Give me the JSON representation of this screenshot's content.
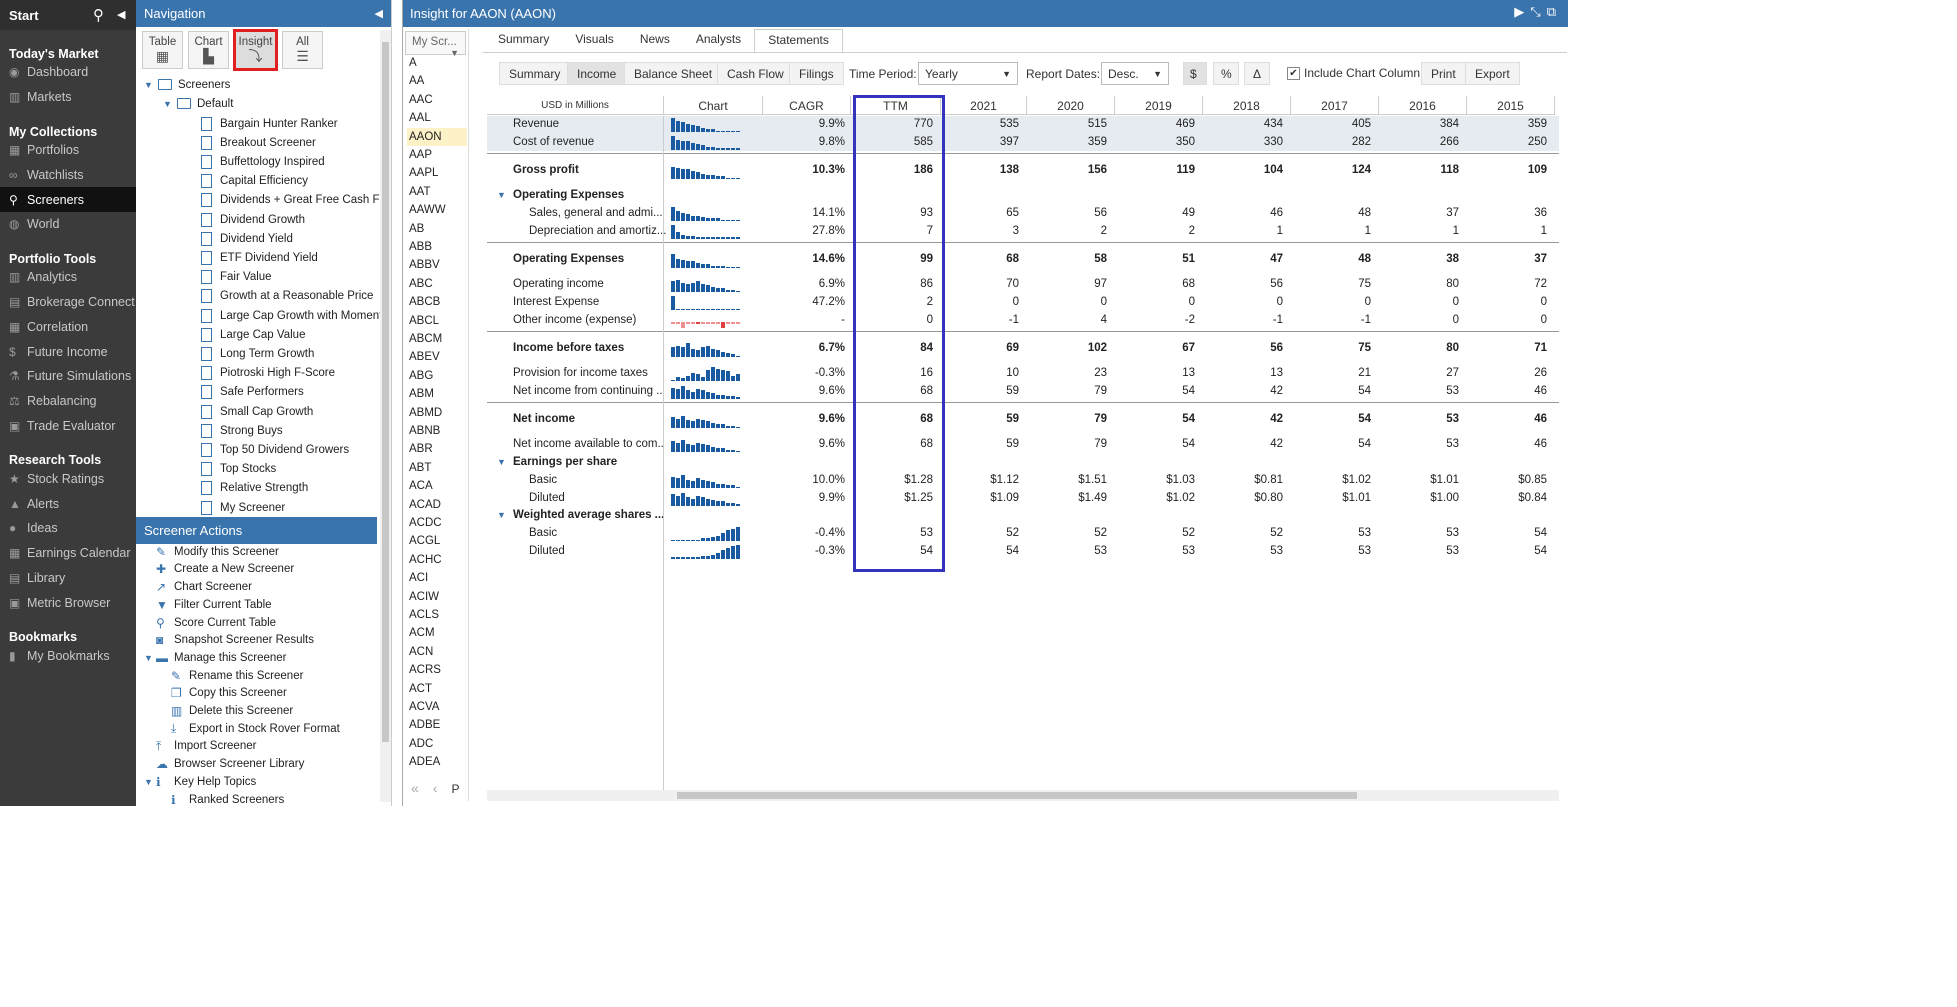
{
  "left": {
    "start": "Start",
    "sections": [
      {
        "title": "Today's Market",
        "items": [
          {
            "label": "Dashboard",
            "icon": "dashboard-icon",
            "g": "◉"
          },
          {
            "label": "Markets",
            "icon": "markets-icon",
            "g": "▥"
          }
        ]
      },
      {
        "title": "My Collections",
        "items": [
          {
            "label": "Portfolios",
            "icon": "portfolio-icon",
            "g": "▦"
          },
          {
            "label": "Watchlists",
            "icon": "binoculars-icon",
            "g": "∞"
          },
          {
            "label": "Screeners",
            "icon": "search-icon",
            "g": "⚲",
            "active": true
          },
          {
            "label": "World",
            "icon": "globe-icon",
            "g": "◍"
          }
        ]
      },
      {
        "title": "Portfolio Tools",
        "items": [
          {
            "label": "Analytics",
            "icon": "analytics-icon",
            "g": "▥"
          },
          {
            "label": "Brokerage Connect",
            "icon": "brokerage-icon",
            "g": "▤"
          },
          {
            "label": "Correlation",
            "icon": "grid-icon",
            "g": "▦"
          },
          {
            "label": "Future Income",
            "icon": "dollar-icon",
            "g": "$"
          },
          {
            "label": "Future Simulations",
            "icon": "flask-icon",
            "g": "⚗"
          },
          {
            "label": "Rebalancing",
            "icon": "scale-icon",
            "g": "⚖"
          },
          {
            "label": "Trade Evaluator",
            "icon": "briefcase-icon",
            "g": "▣"
          }
        ]
      },
      {
        "title": "Research Tools",
        "items": [
          {
            "label": "Stock Ratings",
            "icon": "star-icon",
            "g": "★"
          },
          {
            "label": "Alerts",
            "icon": "bell-icon",
            "g": "▲"
          },
          {
            "label": "Ideas",
            "icon": "bulb-icon",
            "g": "●"
          },
          {
            "label": "Earnings Calendar",
            "icon": "calendar-icon",
            "g": "▦"
          },
          {
            "label": "Library",
            "icon": "library-icon",
            "g": "▤"
          },
          {
            "label": "Metric Browser",
            "icon": "metric-icon",
            "g": "▣"
          }
        ]
      },
      {
        "title": "Bookmarks",
        "items": [
          {
            "label": "My Bookmarks",
            "icon": "bookmark-icon",
            "g": "▮"
          }
        ]
      }
    ]
  },
  "nav": {
    "title": "Navigation",
    "views": [
      "Table",
      "Chart",
      "Insight",
      "All"
    ],
    "screeners": "Screeners",
    "default": "Default",
    "items": [
      "Bargain Hunter Ranker",
      "Breakout Screener",
      "Buffettology Inspired",
      "Capital Efficiency",
      "Dividends + Great Free Cash Flow",
      "Dividend Growth",
      "Dividend Yield",
      "ETF Dividend Yield",
      "Fair Value",
      "Growth at a Reasonable Price",
      "Large Cap Growth with Momentum",
      "Large Cap Value",
      "Long Term Growth",
      "Piotroski High F-Score",
      "Safe Performers",
      "Small Cap Growth",
      "Strong Buys",
      "Top 50 Dividend Growers",
      "Top Stocks",
      "Relative Strength",
      "My Screener"
    ],
    "actions_title": "Screener Actions",
    "actions": [
      {
        "label": "Modify this Screener",
        "g": "✎",
        "indent": 0
      },
      {
        "label": "Create a New Screener",
        "g": "✚",
        "indent": 0
      },
      {
        "label": "Chart Screener",
        "g": "↗",
        "indent": 0
      },
      {
        "label": "Filter Current Table",
        "g": "▼",
        "indent": 0
      },
      {
        "label": "Score Current Table",
        "g": "⚲",
        "indent": 0
      },
      {
        "label": "Snapshot Screener Results",
        "g": "◙",
        "indent": 0
      },
      {
        "label": "Manage this Screener",
        "g": "▬",
        "indent": 0,
        "twisty": true
      },
      {
        "label": "Rename this Screener",
        "g": "✎",
        "indent": 1
      },
      {
        "label": "Copy this Screener",
        "g": "❐",
        "indent": 1
      },
      {
        "label": "Delete this Screener",
        "g": "▥",
        "indent": 1
      },
      {
        "label": "Export in Stock Rover Format",
        "g": "⤓",
        "indent": 1
      },
      {
        "label": "Import Screener",
        "g": "⤒",
        "indent": 0
      },
      {
        "label": "Browser Screener Library",
        "g": "☁",
        "indent": 0
      },
      {
        "label": "Key Help Topics",
        "g": "ℹ",
        "indent": 0,
        "twisty": true
      },
      {
        "label": "Ranked Screeners",
        "g": "ℹ",
        "indent": 1
      }
    ]
  },
  "main": {
    "title": "Insight for AAON (AAON)",
    "ticker_header": "My Scr...",
    "tickers": [
      "A",
      "AA",
      "AAC",
      "AAL",
      "AAON",
      "AAP",
      "AAPL",
      "AAT",
      "AAWW",
      "AB",
      "ABB",
      "ABBV",
      "ABC",
      "ABCB",
      "ABCL",
      "ABCM",
      "ABEV",
      "ABG",
      "ABM",
      "ABMD",
      "ABNB",
      "ABR",
      "ABT",
      "ACA",
      "ACAD",
      "ACDC",
      "ACGL",
      "ACHC",
      "ACI",
      "ACIW",
      "ACLS",
      "ACM",
      "ACN",
      "ACRS",
      "ACT",
      "ACVA",
      "ADBE",
      "ADC",
      "ADEA"
    ],
    "tabs": [
      "Summary",
      "Visuals",
      "News",
      "Analysts",
      "Statements"
    ],
    "subtabs": [
      "Summary",
      "Income",
      "Balance Sheet",
      "Cash Flow",
      "Filings"
    ],
    "period_label": "Time Period:",
    "period": "Yearly",
    "report_label": "Report Dates:",
    "report": "Desc.",
    "fmt": [
      "$",
      "%",
      "Δ"
    ],
    "include": "Include Chart Column",
    "print": "Print",
    "export": "Export",
    "pager": "P"
  },
  "table": {
    "columns": [
      "USD in Millions",
      "Chart",
      "CAGR",
      "TTM",
      "2021",
      "2020",
      "2019",
      "2018",
      "2017",
      "2016",
      "2015"
    ],
    "rows": [
      {
        "label": "Revenue",
        "indent": 0,
        "bold": false,
        "hl": true,
        "cagr": "9.9%",
        "v": [
          "770",
          "535",
          "515",
          "469",
          "434",
          "405",
          "384",
          "359"
        ],
        "s": [
          10,
          8,
          7,
          6,
          5,
          4,
          3,
          2,
          2,
          1,
          1,
          1,
          1,
          1
        ]
      },
      {
        "label": "Cost of revenue",
        "indent": 0,
        "bold": false,
        "hl": true,
        "cagr": "9.8%",
        "v": [
          "585",
          "397",
          "359",
          "350",
          "330",
          "282",
          "266",
          "250"
        ],
        "s": [
          10,
          7,
          6,
          6,
          5,
          4,
          3,
          2,
          2,
          1,
          1,
          1,
          1,
          1
        ]
      },
      {
        "label": "Gross profit",
        "indent": 0,
        "bold": true,
        "gap": true,
        "cagr": "10.3%",
        "v": [
          "186",
          "138",
          "156",
          "119",
          "104",
          "124",
          "118",
          "109"
        ],
        "s": [
          9,
          8,
          7,
          7,
          6,
          5,
          4,
          3,
          3,
          2,
          2,
          1,
          1,
          1
        ]
      },
      {
        "label": "Operating Expenses",
        "indent": 0,
        "bold": true,
        "section": true,
        "cagr": "",
        "v": [
          "",
          "",
          "",
          "",
          "",
          "",
          "",
          ""
        ],
        "s": []
      },
      {
        "label": "Sales, general and admi...",
        "indent": 1,
        "bold": false,
        "cagr": "14.1%",
        "v": [
          "93",
          "65",
          "56",
          "49",
          "46",
          "48",
          "37",
          "36"
        ],
        "s": [
          10,
          7,
          6,
          5,
          4,
          4,
          3,
          2,
          2,
          2,
          1,
          1,
          1,
          1
        ]
      },
      {
        "label": "Depreciation and amortiz...",
        "indent": 1,
        "bold": false,
        "cagr": "27.8%",
        "v": [
          "7",
          "3",
          "2",
          "2",
          "1",
          "1",
          "1",
          "1"
        ],
        "s": [
          10,
          5,
          3,
          2,
          2,
          1,
          1,
          1,
          1,
          1,
          1,
          1,
          1,
          1
        ]
      },
      {
        "label": "Operating Expenses",
        "indent": 0,
        "bold": true,
        "gap": true,
        "cagr": "14.6%",
        "v": [
          "99",
          "68",
          "58",
          "51",
          "47",
          "48",
          "38",
          "37"
        ],
        "s": [
          10,
          7,
          6,
          5,
          5,
          4,
          3,
          3,
          2,
          2,
          2,
          1,
          1,
          1
        ]
      },
      {
        "label": "Operating income",
        "indent": 0,
        "bold": false,
        "cagr": "6.9%",
        "v": [
          "86",
          "70",
          "97",
          "68",
          "56",
          "75",
          "80",
          "72"
        ],
        "s": [
          8,
          9,
          7,
          6,
          7,
          8,
          6,
          5,
          4,
          3,
          3,
          2,
          2,
          1
        ]
      },
      {
        "label": "Interest Expense",
        "indent": 0,
        "bold": false,
        "cagr": "47.2%",
        "v": [
          "2",
          "0",
          "0",
          "0",
          "0",
          "0",
          "0",
          "0"
        ],
        "s": [
          10,
          1,
          1,
          1,
          1,
          1,
          1,
          1,
          1,
          1,
          1,
          1,
          1,
          1
        ]
      },
      {
        "label": "Other income (expense)",
        "indent": 0,
        "bold": false,
        "red": true,
        "cagr": "-",
        "v": [
          "0",
          "-1",
          "4",
          "-2",
          "-1",
          "-1",
          "0",
          "0"
        ],
        "s": [
          2,
          2,
          5,
          3,
          2,
          2,
          2,
          2,
          2,
          2,
          6,
          2,
          2,
          2
        ]
      },
      {
        "label": "Income before taxes",
        "indent": 0,
        "bold": true,
        "gap": true,
        "cagr": "6.7%",
        "v": [
          "84",
          "69",
          "102",
          "67",
          "56",
          "75",
          "80",
          "71"
        ],
        "s": [
          7,
          8,
          7,
          10,
          6,
          5,
          7,
          8,
          6,
          5,
          4,
          3,
          2,
          1
        ]
      },
      {
        "label": "Provision for income taxes",
        "indent": 0,
        "bold": false,
        "cagr": "-0.3%",
        "v": [
          "16",
          "10",
          "23",
          "13",
          "13",
          "21",
          "27",
          "26"
        ],
        "s": [
          1,
          3,
          2,
          4,
          6,
          5,
          3,
          8,
          10,
          9,
          8,
          7,
          4,
          5
        ]
      },
      {
        "label": "Net income from continuing ...",
        "indent": 0,
        "bold": false,
        "cagr": "9.6%",
        "v": [
          "68",
          "59",
          "79",
          "54",
          "42",
          "54",
          "53",
          "46"
        ],
        "s": [
          8,
          7,
          9,
          6,
          5,
          7,
          6,
          5,
          4,
          3,
          3,
          2,
          2,
          1
        ]
      },
      {
        "label": "Net income",
        "indent": 0,
        "bold": true,
        "gap": true,
        "cagr": "9.6%",
        "v": [
          "68",
          "59",
          "79",
          "54",
          "42",
          "54",
          "53",
          "46"
        ],
        "s": [
          8,
          7,
          9,
          6,
          5,
          7,
          6,
          5,
          4,
          3,
          3,
          2,
          2,
          1
        ]
      },
      {
        "label": "Net income available to com...",
        "indent": 0,
        "bold": false,
        "cagr": "9.6%",
        "v": [
          "68",
          "59",
          "79",
          "54",
          "42",
          "54",
          "53",
          "46"
        ],
        "s": [
          8,
          7,
          9,
          6,
          5,
          7,
          6,
          5,
          4,
          3,
          3,
          2,
          2,
          1
        ]
      },
      {
        "label": "Earnings per share",
        "indent": 0,
        "bold": true,
        "section": true,
        "cagr": "",
        "v": [
          "",
          "",
          "",
          "",
          "",
          "",
          "",
          ""
        ],
        "s": []
      },
      {
        "label": "Basic",
        "indent": 1,
        "bold": false,
        "cagr": "10.0%",
        "v": [
          "$1.28",
          "$1.12",
          "$1.51",
          "$1.03",
          "$0.81",
          "$1.02",
          "$1.01",
          "$0.85"
        ],
        "s": [
          8,
          7,
          9,
          6,
          5,
          7,
          6,
          5,
          4,
          3,
          3,
          2,
          2,
          1
        ]
      },
      {
        "label": "Diluted",
        "indent": 1,
        "bold": false,
        "cagr": "9.9%",
        "v": [
          "$1.25",
          "$1.09",
          "$1.49",
          "$1.02",
          "$0.80",
          "$1.01",
          "$1.00",
          "$0.84"
        ],
        "s": [
          8,
          7,
          9,
          6,
          5,
          7,
          6,
          5,
          4,
          3,
          3,
          2,
          2,
          1
        ]
      },
      {
        "label": "Weighted average shares ...",
        "indent": 0,
        "bold": true,
        "section": true,
        "cagr": "",
        "v": [
          "",
          "",
          "",
          "",
          "",
          "",
          "",
          ""
        ],
        "s": []
      },
      {
        "label": "Basic",
        "indent": 1,
        "bold": false,
        "cagr": "-0.4%",
        "v": [
          "53",
          "52",
          "52",
          "52",
          "52",
          "53",
          "53",
          "54"
        ],
        "s": [
          1,
          1,
          1,
          1,
          1,
          1,
          2,
          2,
          3,
          4,
          6,
          8,
          9,
          10
        ]
      },
      {
        "label": "Diluted",
        "indent": 1,
        "bold": false,
        "cagr": "-0.3%",
        "v": [
          "54",
          "54",
          "53",
          "53",
          "53",
          "53",
          "53",
          "54"
        ],
        "s": [
          1,
          1,
          1,
          1,
          1,
          1,
          2,
          2,
          3,
          4,
          6,
          8,
          9,
          10
        ]
      }
    ]
  }
}
